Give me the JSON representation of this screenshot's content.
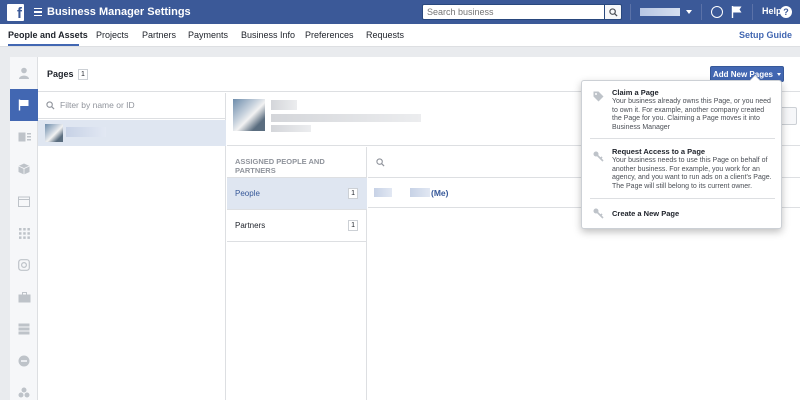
{
  "header": {
    "logo": "f",
    "title": "Business Manager Settings",
    "search_placeholder": "Search business",
    "help_label": "Help",
    "help_icon": "?"
  },
  "nav": {
    "tabs": [
      {
        "label": "People and Assets",
        "active": true
      },
      {
        "label": "Projects"
      },
      {
        "label": "Partners"
      },
      {
        "label": "Payments"
      },
      {
        "label": "Business Info"
      },
      {
        "label": "Preferences"
      },
      {
        "label": "Requests"
      }
    ],
    "setup_guide": "Setup Guide"
  },
  "pages_panel": {
    "title": "Pages",
    "count": "1",
    "add_button": "Add New Pages",
    "filter_placeholder": "Filter by name or ID"
  },
  "assigned": {
    "heading": "ASSIGNED PEOPLE AND PARTNERS",
    "items": [
      {
        "label": "People",
        "count": "1",
        "selected": true
      },
      {
        "label": "Partners",
        "count": "1"
      }
    ],
    "person_suffix": "(Me)"
  },
  "dropdown": {
    "items": [
      {
        "title": "Claim a Page",
        "description": "Your business already owns this Page, or you need to own it. For example, another company created the Page for you. Claiming a Page moves it into Business Manager",
        "icon": "tag-icon"
      },
      {
        "title": "Request Access to a Page",
        "description": "Your business needs to use this Page on behalf of another business. For example, you work for an agency, and you want to run ads on a client's Page. The Page will still belong to its current owner.",
        "icon": "key-icon"
      },
      {
        "title": "Create a New Page",
        "icon": "key-icon"
      }
    ]
  },
  "colors": {
    "brand": "#3b5998",
    "accent": "#4267b2",
    "selected_bg": "#dfe6f1"
  }
}
